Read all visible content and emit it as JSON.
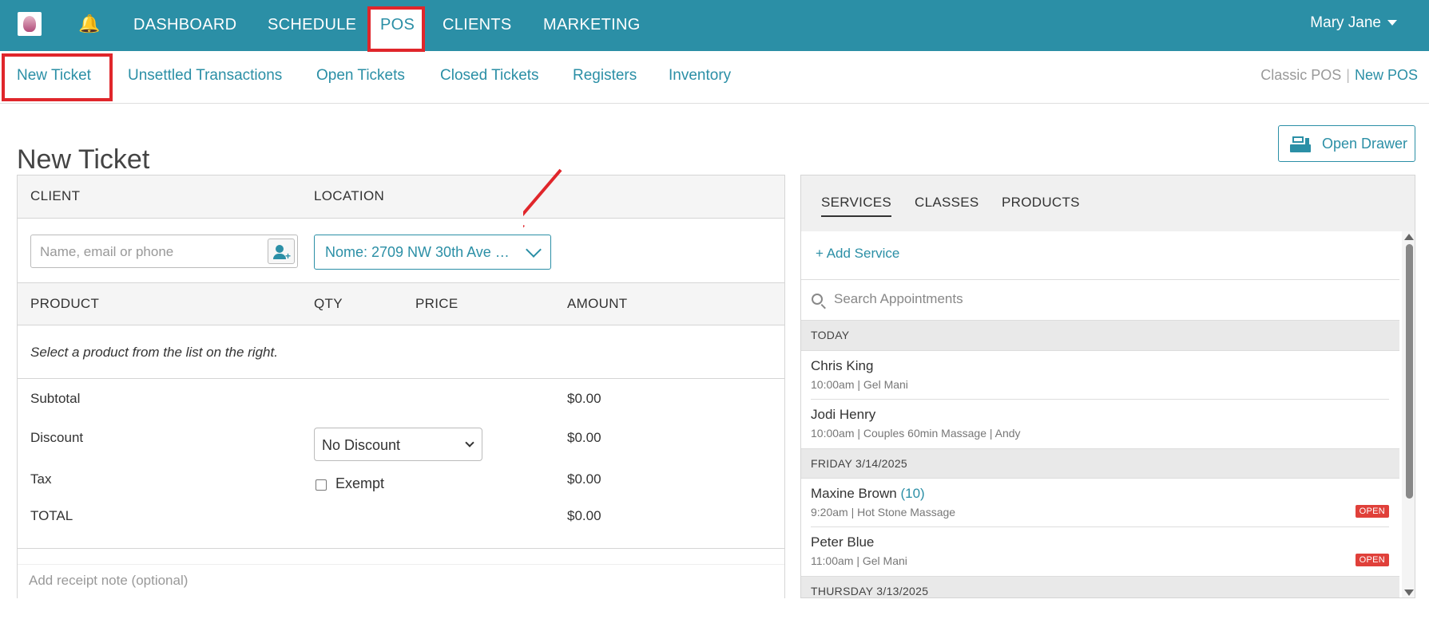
{
  "topnav": {
    "items": [
      "DASHBOARD",
      "SCHEDULE",
      "POS",
      "CLIENTS",
      "MARKETING"
    ],
    "user_name": "Mary Jane"
  },
  "subnav": {
    "items": [
      "New Ticket",
      "Unsettled Transactions",
      "Open Tickets",
      "Closed Tickets",
      "Registers",
      "Inventory"
    ],
    "classic_pos": "Classic POS",
    "separator": "|",
    "new_pos": "New POS"
  },
  "page": {
    "title": "New Ticket",
    "open_drawer": "Open Drawer"
  },
  "ticket": {
    "client_header": "CLIENT",
    "location_header": "LOCATION",
    "client_placeholder": "Name, email or phone",
    "location_value": "Nome: 2709 NW 30th Ave …",
    "columns": [
      "PRODUCT",
      "QTY",
      "PRICE",
      "AMOUNT"
    ],
    "hint": "Select a product from the list on the right.",
    "subtotal_label": "Subtotal",
    "subtotal_value": "$0.00",
    "discount_label": "Discount",
    "discount_value": "$0.00",
    "discount_selected": "No Discount",
    "tax_label": "Tax",
    "tax_value": "$0.00",
    "exempt_label": "Exempt",
    "total_label": "TOTAL",
    "total_value": "$0.00",
    "receipt_placeholder": "Add receipt note (optional)"
  },
  "catalog": {
    "tabs": [
      "SERVICES",
      "CLASSES",
      "PRODUCTS"
    ],
    "add_service": "+ Add Service",
    "search_placeholder": "Search Appointments",
    "groups": [
      {
        "label": "TODAY",
        "appointments": [
          {
            "name": "Chris King",
            "count": "",
            "meta": "10:00am | Gel Mani",
            "badge": ""
          },
          {
            "name": "Jodi Henry",
            "count": "",
            "meta": "10:00am | Couples 60min Massage | Andy",
            "badge": ""
          }
        ]
      },
      {
        "label": "FRIDAY 3/14/2025",
        "appointments": [
          {
            "name": "Maxine Brown",
            "count": "(10)",
            "meta": "9:20am | Hot Stone Massage",
            "badge": "OPEN"
          },
          {
            "name": "Peter Blue",
            "count": "",
            "meta": "11:00am | Gel Mani",
            "badge": "OPEN"
          }
        ]
      },
      {
        "label": "THURSDAY 3/13/2025",
        "appointments": []
      }
    ]
  },
  "colors": {
    "brand": "#2b8fa6",
    "highlight": "#e0262b",
    "badge": "#e0403a"
  }
}
